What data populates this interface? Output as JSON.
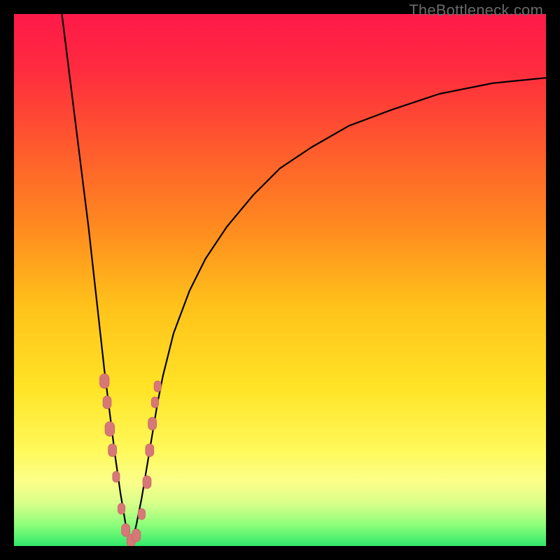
{
  "watermark": "TheBottleneck.com",
  "colors": {
    "frame": "#000000",
    "gradient_stops": [
      {
        "pos": 0.0,
        "color": "#ff1a49"
      },
      {
        "pos": 0.1,
        "color": "#ff2a3f"
      },
      {
        "pos": 0.25,
        "color": "#ff5a2d"
      },
      {
        "pos": 0.4,
        "color": "#ff8a1f"
      },
      {
        "pos": 0.55,
        "color": "#ffc21a"
      },
      {
        "pos": 0.7,
        "color": "#ffe325"
      },
      {
        "pos": 0.82,
        "color": "#fff95a"
      },
      {
        "pos": 0.88,
        "color": "#fbff8a"
      },
      {
        "pos": 0.92,
        "color": "#d8ff8a"
      },
      {
        "pos": 0.96,
        "color": "#8dff7a"
      },
      {
        "pos": 1.0,
        "color": "#30e96b"
      }
    ],
    "curve": "#000000",
    "marker_fill": "#d87777",
    "marker_stroke": "#c76666"
  },
  "chart_data": {
    "type": "line",
    "title": "",
    "xlabel": "",
    "ylabel": "",
    "xlim": [
      0,
      100
    ],
    "ylim": [
      0,
      100
    ],
    "grid": false,
    "series": [
      {
        "name": "left-branch",
        "x": [
          9,
          10,
          11,
          12,
          13,
          14,
          15,
          16,
          17,
          18,
          19,
          20,
          21,
          22
        ],
        "y": [
          100,
          92,
          84,
          76,
          68,
          60,
          51,
          42,
          33,
          25,
          17,
          10,
          4,
          0
        ]
      },
      {
        "name": "right-branch",
        "x": [
          22,
          23,
          24,
          25,
          26,
          27,
          28,
          30,
          33,
          36,
          40,
          45,
          50,
          56,
          63,
          71,
          80,
          90,
          100
        ],
        "y": [
          0,
          4,
          9,
          15,
          21,
          27,
          32,
          40,
          48,
          54,
          60,
          66,
          71,
          75,
          79,
          82,
          85,
          87,
          88
        ]
      }
    ],
    "markers": [
      {
        "x": 17.0,
        "y": 31,
        "r": 8
      },
      {
        "x": 17.5,
        "y": 27,
        "r": 7
      },
      {
        "x": 18.0,
        "y": 22,
        "r": 8
      },
      {
        "x": 18.5,
        "y": 18,
        "r": 7
      },
      {
        "x": 19.2,
        "y": 13,
        "r": 6
      },
      {
        "x": 20.2,
        "y": 7,
        "r": 6
      },
      {
        "x": 21.0,
        "y": 3,
        "r": 7
      },
      {
        "x": 22.0,
        "y": 1,
        "r": 7
      },
      {
        "x": 23.0,
        "y": 2,
        "r": 7
      },
      {
        "x": 24.0,
        "y": 6,
        "r": 6
      },
      {
        "x": 25.0,
        "y": 12,
        "r": 7
      },
      {
        "x": 25.5,
        "y": 18,
        "r": 7
      },
      {
        "x": 26.0,
        "y": 23,
        "r": 7
      },
      {
        "x": 26.5,
        "y": 27,
        "r": 6
      },
      {
        "x": 27.0,
        "y": 30,
        "r": 6
      }
    ]
  }
}
